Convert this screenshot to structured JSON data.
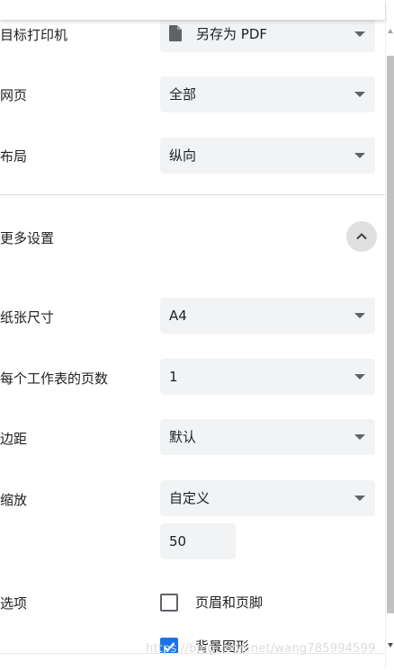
{
  "destination": {
    "label": "目标打印机",
    "value": "另存为 PDF",
    "icon": "file-icon"
  },
  "pages": {
    "label": "网页",
    "value": "全部"
  },
  "layout": {
    "label": "布局",
    "value": "纵向"
  },
  "more_settings": {
    "label": "更多设置",
    "icon": "chevron-up-icon"
  },
  "paper_size": {
    "label": "纸张尺寸",
    "value": "A4"
  },
  "pages_per_sheet": {
    "label": "每个工作表的页数",
    "value": "1"
  },
  "margins": {
    "label": "边距",
    "value": "默认"
  },
  "scale": {
    "label": "缩放",
    "value": "自定义",
    "custom_value": "50"
  },
  "options": {
    "label": "选项",
    "headers_footers": {
      "label": "页眉和页脚",
      "checked": false
    },
    "background_graphics": {
      "label": "背景图形",
      "checked": true
    }
  },
  "watermark": "https://blog.csdn.net/wang785994599",
  "colors": {
    "field_bg": "#f1f3f4",
    "checkbox_accent": "#1a73e8"
  }
}
